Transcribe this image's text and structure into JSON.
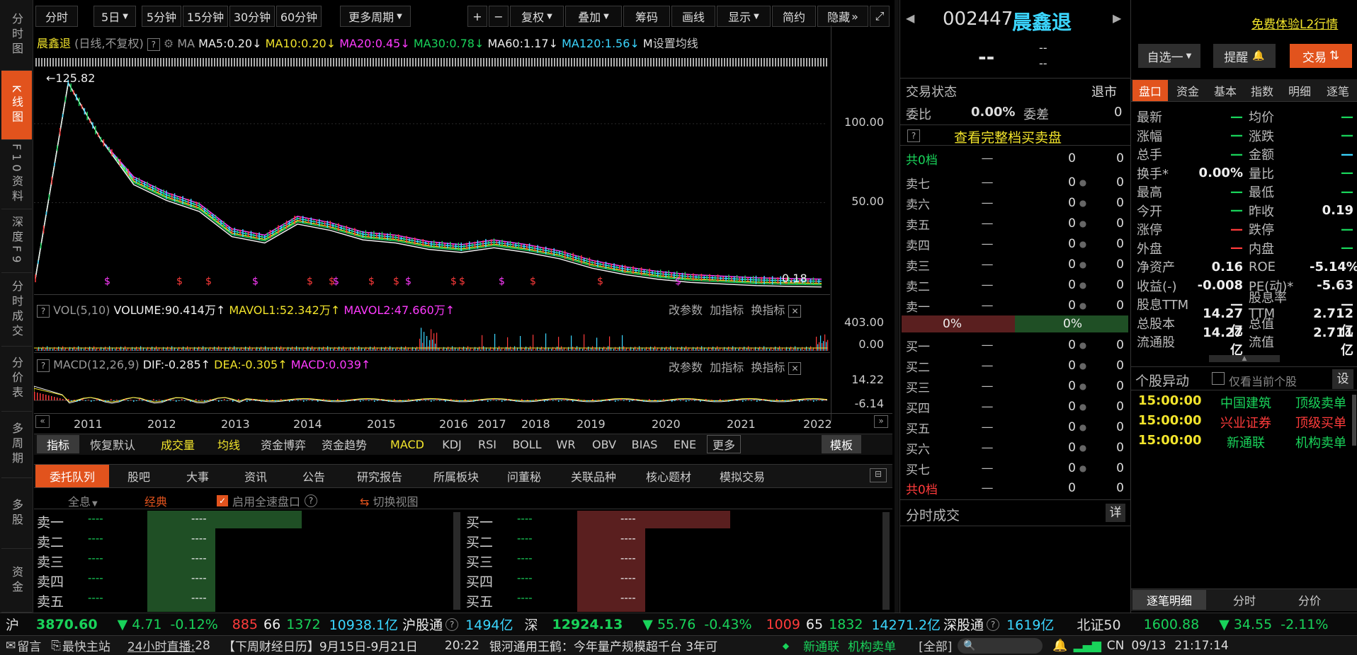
{
  "left_nav": [
    "分时图",
    "K线图",
    "F10资料",
    "深度F9",
    "分时成交",
    "分价表",
    "多周期",
    "多股",
    "资金"
  ],
  "toolbar": {
    "periods": [
      "分时",
      "5日",
      "5分钟",
      "15分钟",
      "30分钟",
      "60分钟",
      "更多周期"
    ],
    "tools": [
      "+",
      "−",
      "复权",
      "叠加",
      "筹码",
      "画线",
      "显示",
      "简约",
      "隐藏"
    ]
  },
  "chart_legend": {
    "name": "晨鑫退",
    "mode": "(日线,不复权)",
    "ma_label": "MA",
    "ma5": "MA5:0.20",
    "ma10": "MA10:0.20",
    "ma20": "MA20:0.45",
    "ma30": "MA30:0.78",
    "ma60": "MA60:1.17",
    "ma120": "MA120:1.56",
    "ma_more": "M",
    "setting": "设置均线"
  },
  "chart_data": {
    "type": "line",
    "title": "",
    "x": [
      "2011",
      "2012",
      "2013",
      "2014",
      "2015",
      "2016",
      "2017",
      "2018",
      "2019",
      "2020",
      "2021",
      "2022"
    ],
    "y_ticks": [
      "100.00",
      "50.00"
    ],
    "max_label": "←125.82",
    "last_label": "0.18",
    "price": [
      2,
      125.82,
      90,
      65,
      55,
      48,
      32,
      28,
      40,
      36,
      30,
      28,
      24,
      22,
      25,
      22,
      18,
      12,
      8,
      5,
      3,
      2,
      1,
      0.5,
      0.18
    ],
    "ylim": [
      0,
      130
    ]
  },
  "vol_panel": {
    "name": "VOL(5,10)",
    "volume": "VOLUME:90.414万",
    "mavol1": "MAVOL1:52.342万",
    "mavol2": "MAVOL2:47.660万",
    "actions": [
      "改参数",
      "加指标",
      "换指标"
    ],
    "y_ticks": [
      "403.00",
      "0.00"
    ]
  },
  "macd_panel": {
    "name": "MACD(12,26,9)",
    "dif": "DIF:-0.285",
    "dea": "DEA:-0.305",
    "macd": "MACD:0.039",
    "actions": [
      "改参数",
      "加指标",
      "换指标"
    ],
    "y_ticks": [
      "14.22",
      "-6.14"
    ]
  },
  "indicator_tabs": [
    "指标",
    "恢复默认",
    "成交量",
    "均线",
    "资金博弈",
    "资金趋势",
    "MACD",
    "KDJ",
    "RSI",
    "BOLL",
    "WR",
    "OBV",
    "BIAS",
    "ENE",
    "更多",
    "模板"
  ],
  "bottom_tabs": [
    "委托队列",
    "股吧",
    "大事",
    "资讯",
    "公告",
    "研究报告",
    "所属板块",
    "问董秘",
    "关联品种",
    "核心题材",
    "模拟交易"
  ],
  "queue_controls": {
    "all": "全息",
    "classic": "经典",
    "enable": "启用全速盘口",
    "switch": "切换视图"
  },
  "queue_sell": [
    "卖一",
    "卖二",
    "卖三",
    "卖四",
    "卖五"
  ],
  "queue_buy": [
    "买一",
    "买二",
    "买三",
    "买四",
    "买五"
  ],
  "queue_dash": "----",
  "stock": {
    "code": "002447",
    "name": "晨鑫退",
    "price": "--",
    "change": "--",
    "pct": "--",
    "l2": "免费体验L2行情",
    "btn_watch": "自选一",
    "btn_alert": "提醒",
    "btn_trade": "交易"
  },
  "trade_status": {
    "label": "交易状态",
    "value": "退市",
    "wb_label": "委比",
    "wb": "0.00%",
    "wc_label": "委差",
    "wc": "0",
    "view_full": "查看完整档买卖盘"
  },
  "order_book": {
    "sell_total": "共0档",
    "buy_total": "共0档",
    "sells": [
      "卖七",
      "卖六",
      "卖五",
      "卖四",
      "卖三",
      "卖二",
      "卖一"
    ],
    "buys": [
      "买一",
      "买二",
      "买三",
      "买四",
      "买五",
      "买六",
      "买七"
    ],
    "dash": "—",
    "zero": "0",
    "pct_left": "0%",
    "pct_right": "0%",
    "intraday": "分时成交",
    "detail": "详"
  },
  "quote_tabs": [
    "盘口",
    "资金",
    "基本",
    "指数",
    "明细",
    "逐笔"
  ],
  "quote": [
    [
      "最新",
      "—",
      "均价",
      "—"
    ],
    [
      "涨幅",
      "—",
      "涨跌",
      "—"
    ],
    [
      "总手",
      "—",
      "金额",
      "—"
    ],
    [
      "换手*",
      "0.00%",
      "量比",
      "—"
    ],
    [
      "最高",
      "—",
      "最低",
      "—"
    ],
    [
      "今开",
      "—",
      "昨收",
      "0.19"
    ],
    [
      "涨停",
      "—",
      "跌停",
      "—"
    ],
    [
      "外盘",
      "—",
      "内盘",
      "—"
    ],
    [
      "净资产",
      "0.16",
      "ROE",
      "-5.14%"
    ],
    [
      "收益(-)",
      "-0.008",
      "PE(动)*",
      "-5.63"
    ],
    [
      "股息TTM",
      "—",
      "股息率TTM",
      "—"
    ],
    [
      "总股本",
      "14.27亿",
      "总值",
      "2.712亿"
    ],
    [
      "流通股",
      "14.27亿",
      "流值",
      "2.711亿"
    ]
  ],
  "anomaly": {
    "title": "个股异动",
    "only_current": "仅看当前个股",
    "setting": "设",
    "rows": [
      [
        "15:00:00",
        "中国建筑",
        "顶级卖单"
      ],
      [
        "15:00:00",
        "兴业证券",
        "顶级买单"
      ],
      [
        "15:00:00",
        "新通联",
        "机构卖单"
      ]
    ]
  },
  "far_bottom_tabs": [
    "逐笔明细",
    "分时",
    "分价"
  ],
  "ticker": {
    "sh": "沪",
    "sh_val": "3870.60",
    "sh_chg": "▼ 4.71",
    "sh_pct": "-0.12%",
    "sh_up": "885",
    "sh_flat": "66",
    "sh_down": "1372",
    "sh_amt": "10938.1亿",
    "hgt": "沪股通",
    "hgt_val": "1494亿",
    "sz": "深",
    "sz_val": "12924.13",
    "sz_chg": "▼ 55.76",
    "sz_pct": "-0.43%",
    "sz_up": "1009",
    "sz_flat": "65",
    "sz_down": "1832",
    "sz_amt": "14271.2亿",
    "sgt": "深股通",
    "sgt_val": "1619亿",
    "bz": "北证50",
    "bz_val": "1600.88",
    "bz_chg": "▼ 34.55",
    "bz_pct": "-2.11%"
  },
  "status": {
    "msg": "留言",
    "fast": "最快主站",
    "live": "24小时直播:",
    "live_n": "28",
    "news1": "【下周财经日历】9月15日-9月21日",
    "time1": "20:22",
    "news2": "银河通用王鹤：今年量产规模超千台 3年可",
    "scroll_stock": "新通联",
    "scroll_type": "机构卖单",
    "all": "[全部]",
    "cn": "CN",
    "date": "09/13",
    "clock": "21:17:14"
  }
}
